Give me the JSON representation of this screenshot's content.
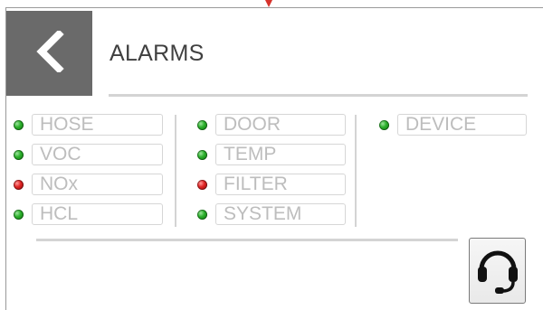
{
  "header": {
    "title": "ALARMS",
    "back_icon": "chevron-left-icon"
  },
  "alarms": {
    "column1": [
      {
        "label": "HOSE",
        "status": "green"
      },
      {
        "label": "VOC",
        "status": "green"
      },
      {
        "label": "NOx",
        "status": "red"
      },
      {
        "label": "HCL",
        "status": "green"
      }
    ],
    "column2": [
      {
        "label": "DOOR",
        "status": "green"
      },
      {
        "label": "TEMP",
        "status": "green"
      },
      {
        "label": "FILTER",
        "status": "red"
      },
      {
        "label": "SYSTEM",
        "status": "green"
      }
    ],
    "column3": [
      {
        "label": "DEVICE",
        "status": "green"
      }
    ]
  },
  "colors": {
    "ok": "#2bb02b",
    "alarm": "#e02424",
    "header_button": "#6a6a6a"
  },
  "footer": {
    "support_icon": "headset-icon"
  }
}
